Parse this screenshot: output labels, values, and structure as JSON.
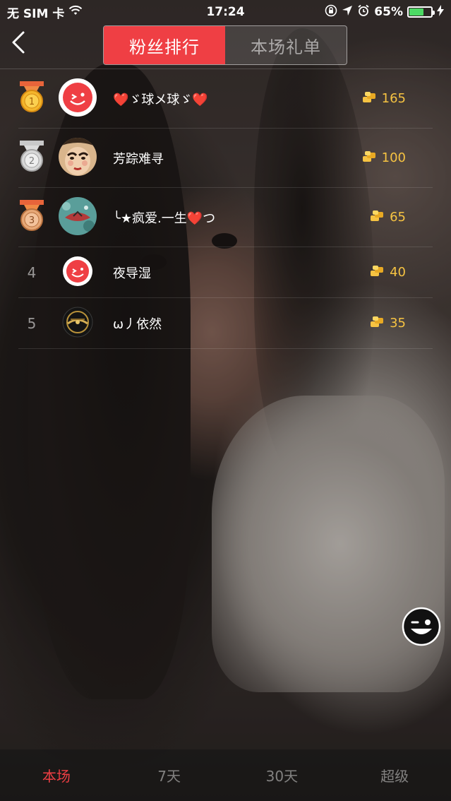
{
  "status_bar": {
    "carrier": "无 SIM 卡",
    "time": "17:24",
    "battery_percent": "65%",
    "battery_level": 0.65,
    "icons": [
      "wifi-icon",
      "rotation-lock-icon",
      "location-icon",
      "alarm-icon",
      "battery-icon",
      "charging-icon"
    ]
  },
  "header": {
    "back_icon": "chevron-left-icon",
    "tabs": [
      {
        "label": "粉丝排行",
        "active": true
      },
      {
        "label": "本场礼单",
        "active": false
      }
    ]
  },
  "ranking": [
    {
      "rank": "1",
      "badge": "gold-medal-icon",
      "avatar": "brand-smiley-avatar",
      "name": "❤️ゞ球メ球ゞ❤️",
      "score": "165",
      "score_icon": "gold-coin-icon"
    },
    {
      "rank": "2",
      "badge": "silver-medal-icon",
      "avatar": "opera-mask-avatar",
      "name": "芳踪难寻",
      "score": "100",
      "score_icon": "gold-coin-icon"
    },
    {
      "rank": "3",
      "badge": "bronze-medal-icon",
      "avatar": "teal-photo-avatar",
      "name": "╰★疯爱.一生❤️つ",
      "score": "65",
      "score_icon": "gold-coin-icon"
    },
    {
      "rank": "4",
      "badge": "",
      "avatar": "brand-smiley-avatar",
      "name": "夜导湿",
      "score": "40",
      "score_icon": "gold-coin-icon"
    },
    {
      "rank": "5",
      "badge": "",
      "avatar": "game-logo-avatar",
      "name": "ω丿依然",
      "score": "35",
      "score_icon": "gold-coin-icon"
    }
  ],
  "floating_button_icon": "wink-smiley-icon",
  "bottom_tabs": [
    {
      "label": "本场",
      "active": true
    },
    {
      "label": "7天",
      "active": false
    },
    {
      "label": "30天",
      "active": false
    },
    {
      "label": "超级",
      "active": false
    }
  ],
  "colors": {
    "accent_red": "#ef3f44",
    "coin_gold": "#f6c342"
  }
}
